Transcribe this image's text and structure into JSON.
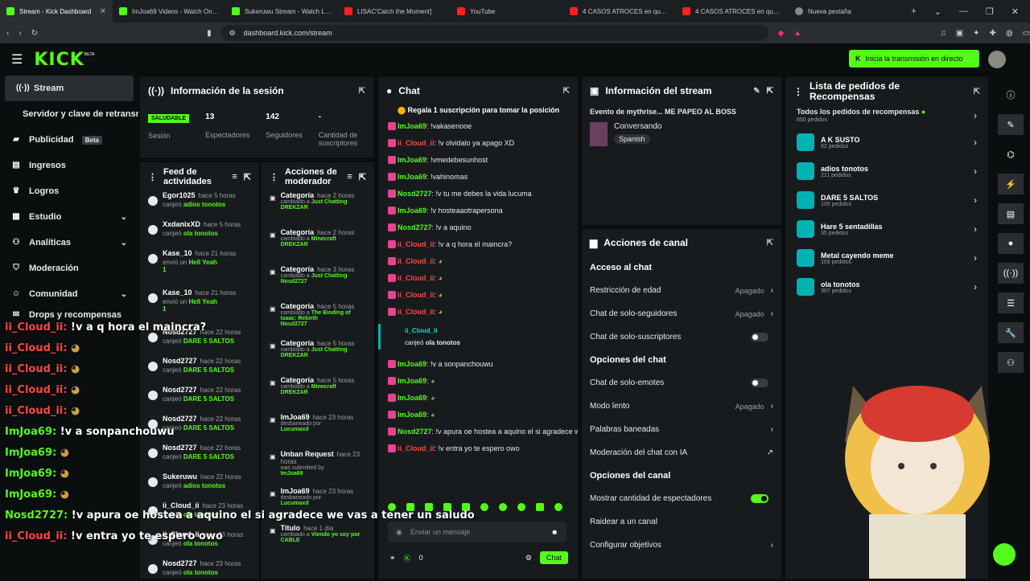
{
  "browser": {
    "tabs": [
      {
        "label": "Stream - Kick Dashboard",
        "color": "#53fc18"
      },
      {
        "label": "ImJoa69 Videos - Watch On-De",
        "color": "#53fc18"
      },
      {
        "label": "Sukeruwu Stream - Watch Live",
        "color": "#53fc18"
      },
      {
        "label": "LISAC'Catch the Moment]",
        "color": "#ff2020"
      },
      {
        "label": "YouTube",
        "color": "#ff2020"
      },
      {
        "label": "4 CASOS ATROCES en que EL T",
        "color": "#ff2020"
      },
      {
        "label": "4 CASOS ATROCES en que EL T",
        "color": "#ff2020"
      },
      {
        "label": "Nueva pestaña",
        "color": "#888"
      }
    ],
    "url": "dashboard.kick.com/stream"
  },
  "topbar": {
    "logo": "KICK",
    "logo_sup": "BETA",
    "go_live": "Inicia la transmisión en directo"
  },
  "sidebar": {
    "items": [
      {
        "label": "Stream",
        "icon": "broadcast-icon"
      },
      {
        "label": "Servidor y clave de retransmisión",
        "icon": ""
      },
      {
        "label": "Publicidad",
        "icon": "megaphone-icon",
        "badge": "Beta"
      },
      {
        "label": "Ingresos",
        "icon": "chart-icon"
      },
      {
        "label": "Logros",
        "icon": "trophy-icon"
      },
      {
        "label": "Estudio",
        "icon": "studio-icon"
      },
      {
        "label": "Analíticas",
        "icon": "analytics-icon"
      },
      {
        "label": "Moderación",
        "icon": "shield-icon"
      },
      {
        "label": "Comunidad",
        "icon": "people-icon"
      },
      {
        "label": "Drops y recompensas",
        "icon": "gift-icon"
      }
    ]
  },
  "session": {
    "title": "Información de la sesión",
    "status": "SALUDABLE",
    "status_label": "Sesión",
    "viewers": "13",
    "viewers_label": "Espectadores",
    "followers": "142",
    "followers_label": "Seguidores",
    "subs": "-",
    "subs_label": "Cantidad de suscriptores"
  },
  "feed": {
    "title": "Feed de actividades",
    "items": [
      {
        "name": "Egor1025",
        "time": "hace 5 horas",
        "action": "canjeó",
        "target": "adios tonotos"
      },
      {
        "name": "XxdanixXD",
        "time": "hace 5 horas",
        "action": "canjeó",
        "target": "ola tonotos"
      },
      {
        "name": "Kase_10",
        "time": "hace 21 horas",
        "action": "envió un",
        "target": "Hell Yeah",
        "count": "1"
      },
      {
        "name": "Kase_10",
        "time": "hace 21 horas",
        "action": "envió un",
        "target": "Hell Yeah",
        "count": "1"
      },
      {
        "name": "Nosd2727",
        "time": "hace 22 horas",
        "action": "canjeó",
        "target": "DARE 5 SALTOS"
      },
      {
        "name": "Nosd2727",
        "time": "hace 22 horas",
        "action": "canjeó",
        "target": "DARE 5 SALTOS"
      },
      {
        "name": "Nosd2727",
        "time": "hace 22 horas",
        "action": "canjeó",
        "target": "DARE 5 SALTOS"
      },
      {
        "name": "Nosd2727",
        "time": "hace 22 horas",
        "action": "canjeó",
        "target": "DARE 5 SALTOS"
      },
      {
        "name": "Nosd2727",
        "time": "hace 22 horas",
        "action": "canjeó",
        "target": "DARE 5 SALTOS"
      },
      {
        "name": "Sukeruwu",
        "time": "hace 22 horas",
        "action": "canjeó",
        "target": "adios tonotos"
      },
      {
        "name": "ii_Cloud_ii",
        "time": "hace 23 horas",
        "action": "canjeó",
        "target": "ola tonotos"
      },
      {
        "name": "ii_Cloud_ii",
        "time": "hace 23 horas",
        "action": "canjeó",
        "target": "ola tonotos"
      },
      {
        "name": "Nosd2727",
        "time": "hace 23 horas",
        "action": "canjeó",
        "target": "ola tonotos"
      }
    ]
  },
  "modactions": {
    "title": "Acciones de moderador",
    "items": [
      {
        "name": "Categoría",
        "time": "hace 2 horas",
        "desc": "cambiado a",
        "target": "Just Chatting",
        "by": "DREKZAR"
      },
      {
        "name": "Categoría",
        "time": "hace 2 horas",
        "desc": "cambiado a",
        "target": "Minecraft",
        "by": "DREKZAR"
      },
      {
        "name": "Categoría",
        "time": "hace 3 horas",
        "desc": "cambiado a",
        "target": "Just Chatting",
        "by": "Nosd2727"
      },
      {
        "name": "Categoría",
        "time": "hace 5 horas",
        "desc": "cambiado a",
        "target": "The Binding of Isaac: Rebirth",
        "by": "Nosd2727"
      },
      {
        "name": "Categoría",
        "time": "hace 5 horas",
        "desc": "cambiado a",
        "target": "Just Chatting",
        "by": "DREKZAR"
      },
      {
        "name": "Categoría",
        "time": "hace 5 horas",
        "desc": "cambiado a",
        "target": "Minecraft",
        "by": "DREKZAR"
      },
      {
        "name": "ImJoa69",
        "time": "hace 23 horas",
        "desc": "desbaneado por",
        "target": "",
        "by": "Lucumaxd"
      },
      {
        "name": "Unban Request",
        "time": "hace 23 horas",
        "desc": "was submitted by",
        "target": "",
        "by": "ImJoa69"
      },
      {
        "name": "ImJoa69",
        "time": "hace 23 horas",
        "desc": "desbaneado por",
        "target": "",
        "by": "Lucumaxd"
      },
      {
        "name": "Título",
        "time": "hace 1 día",
        "desc": "cambiado a",
        "target": "Viendo yo soy por CABLE",
        "by": ""
      }
    ]
  },
  "chat": {
    "title": "Chat",
    "pinned": "Regala 1 suscripción para tomar la posición",
    "messages": [
      {
        "user": "ImJoa69",
        "color": "#53fc18",
        "text": "!vakasenooe"
      },
      {
        "user": "ii_Cloud_ii",
        "color": "#ff4545",
        "text": "!v olvidalo ya apago XD"
      },
      {
        "user": "ImJoa69",
        "color": "#53fc18",
        "text": "!vmedebesunhost"
      },
      {
        "user": "ImJoa69",
        "color": "#53fc18",
        "text": "!vahinomas"
      },
      {
        "user": "Nosd2727",
        "color": "#53fc18",
        "text": "!v tu me debes la vida lucuma"
      },
      {
        "user": "ImJoa69",
        "color": "#53fc18",
        "text": "!v hosteaaotrapersona"
      },
      {
        "user": "Nosd2727",
        "color": "#53fc18",
        "text": "!v a aquino"
      },
      {
        "user": "ii_Cloud_ii",
        "color": "#ff4545",
        "text": "!v a q hora el maincra?"
      },
      {
        "user": "ii_Cloud_ii",
        "color": "#ff4545",
        "text": ""
      },
      {
        "user": "ii_Cloud_ii",
        "color": "#ff4545",
        "text": ""
      },
      {
        "user": "ii_Cloud_ii",
        "color": "#ff4545",
        "text": ""
      },
      {
        "user": "ii_Cloud_ii",
        "color": "#ff4545",
        "text": ""
      }
    ],
    "redeem": {
      "user": "ii_Cloud_ii",
      "action": "canjeó",
      "target": "ola tonotos"
    },
    "messages2": [
      {
        "user": "ImJoa69",
        "color": "#53fc18",
        "text": "!v a sonpanchouwu"
      },
      {
        "user": "ImJoa69",
        "color": "#53fc18",
        "text": ""
      },
      {
        "user": "ImJoa69",
        "color": "#53fc18",
        "text": ""
      },
      {
        "user": "ImJoa69",
        "color": "#53fc18",
        "text": ""
      },
      {
        "user": "Nosd2727",
        "color": "#53fc18",
        "text": "!v apura oe hostea a aquino el si agradece we vas a tener un saludo"
      },
      {
        "user": "ii_Cloud_ii",
        "color": "#ff4545",
        "text": "!v entra yo te espero owo"
      }
    ],
    "input_placeholder": "Enviar un mensaje",
    "send_label": "Chat",
    "kicks": "0"
  },
  "streaminfo": {
    "title": "Información del stream",
    "stream_title": "Evento de mythrise... ME PAPEO AL BOSS",
    "category": "Conversando",
    "language": "Spanish"
  },
  "channel": {
    "title": "Acciones de canal",
    "chat_access": "Acceso al chat",
    "age": "Restricción de edad",
    "age_val": "Apagado",
    "followers_only": "Chat de solo-seguidores",
    "followers_val": "Apagado",
    "subs_only": "Chat de solo-suscriptores",
    "chat_options": "Opciones del chat",
    "emotes_only": "Chat de solo-emotes",
    "slow": "Modo lento",
    "slow_val": "Apagado",
    "banned_words": "Palabras baneadas",
    "ai_mod": "Moderación del chat con IA",
    "channel_options": "Opciones del canal",
    "show_viewers": "Mostrar cantidad de espectadores",
    "raid": "Raidear a un canal",
    "goals": "Configurar objetivos"
  },
  "rewards": {
    "title": "Lista de pedidos de Recompensas",
    "all": "Todos los pedidos de recompensas",
    "all_count": "850 pedidos",
    "items": [
      {
        "name": "A K SUSTO",
        "count": "62 pedidos"
      },
      {
        "name": "adios tonotos",
        "count": "211 pedidos"
      },
      {
        "name": "DARE 5 SALTOS",
        "count": "105 pedidos"
      },
      {
        "name": "Hare 5 sentadillas",
        "count": "35 pedidos"
      },
      {
        "name": "Metal cayendo meme",
        "count": "109 pedidos"
      },
      {
        "name": "ola tonotos",
        "count": "307 pedidos"
      }
    ]
  },
  "overlay": {
    "lines": [
      {
        "user": "ii_Cloud_ii:",
        "text": "!v a q hora el maincra?",
        "ucolor": "red"
      },
      {
        "user": "ii_Cloud_ii:",
        "text": "",
        "ucolor": "red"
      },
      {
        "user": "ii_Cloud_ii:",
        "text": "",
        "ucolor": "red"
      },
      {
        "user": "ii_Cloud_ii:",
        "text": "",
        "ucolor": "red"
      },
      {
        "user": "ii_Cloud_ii:",
        "text": "",
        "ucolor": "red"
      },
      {
        "user": "ImJoa69:",
        "text": "!v a sonpanchouwu",
        "ucolor": "green"
      },
      {
        "user": "ImJoa69:",
        "text": "",
        "ucolor": "green"
      },
      {
        "user": "ImJoa69:",
        "text": "",
        "ucolor": "green"
      },
      {
        "user": "ImJoa69:",
        "text": "",
        "ucolor": "green"
      },
      {
        "user": "Nosd2727:",
        "text": "!v apura oe hostea a aquino el si agradece we vas a tener un saludo",
        "ucolor": "green"
      },
      {
        "user": "ii_Cloud_ii:",
        "text": "!v entra yo te espero owo",
        "ucolor": "red"
      }
    ]
  }
}
